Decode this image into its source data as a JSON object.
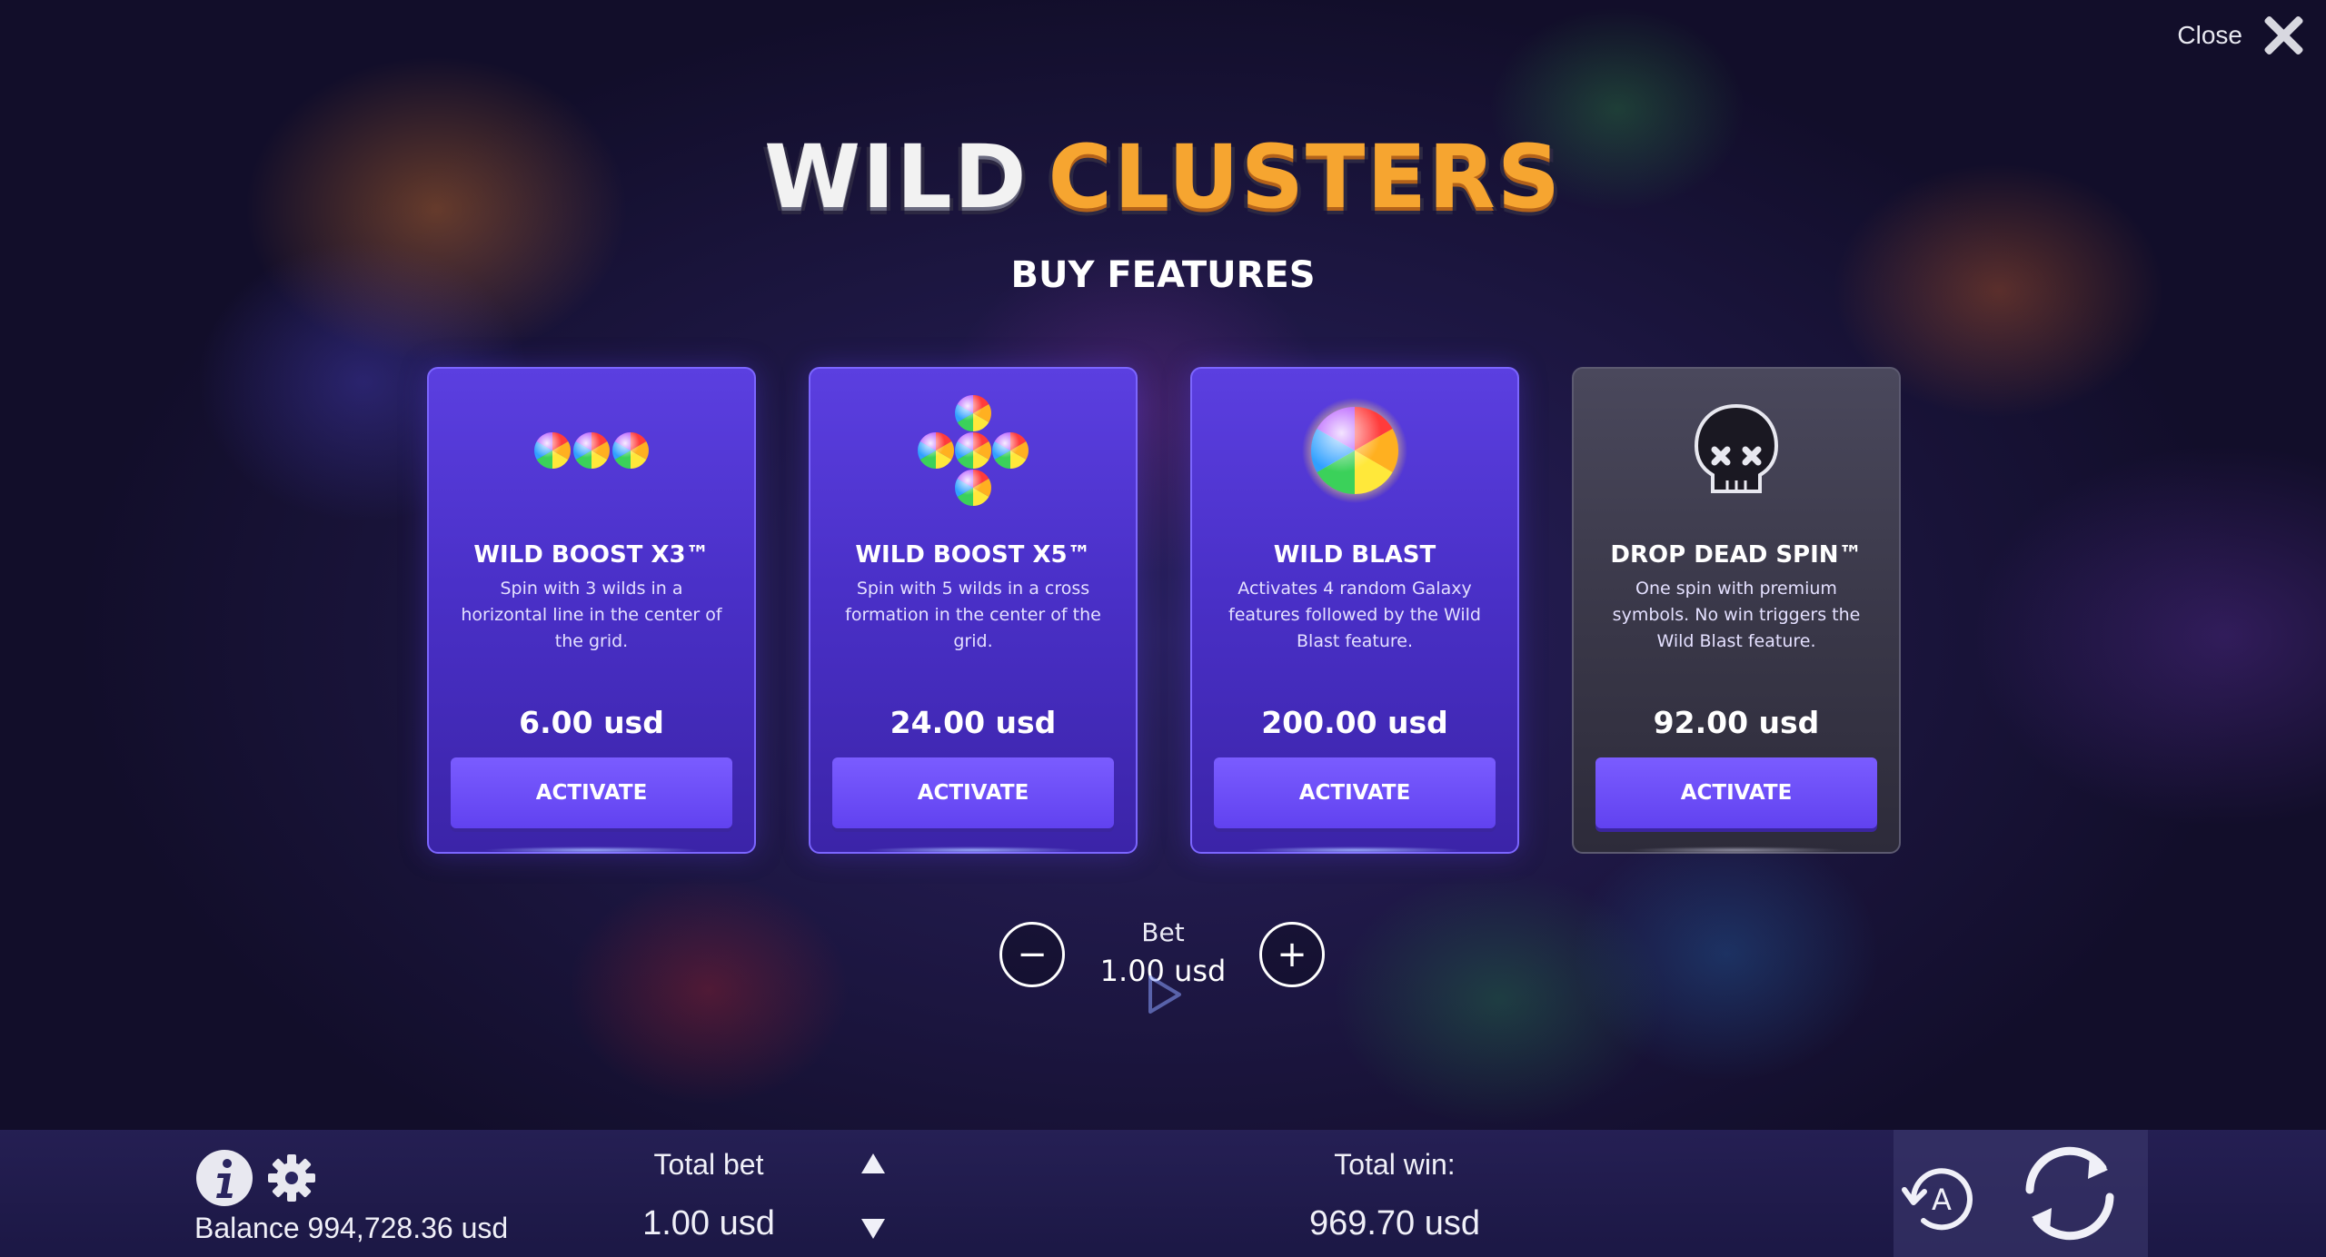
{
  "close": {
    "label": "Close"
  },
  "logo": {
    "word1": "WILD",
    "word2": "CLUSTERS"
  },
  "heading": "BUY FEATURES",
  "cards": [
    {
      "title": "WILD BOOST X3™",
      "description": "Spin with 3 wilds in a horizontal line in the center of the grid.",
      "price": "6.00 usd",
      "button": "ACTIVATE",
      "icon": "three-wild-orbs-icon"
    },
    {
      "title": "WILD BOOST X5™",
      "description": "Spin with 5 wilds in a cross formation in the center of the grid.",
      "price": "24.00 usd",
      "button": "ACTIVATE",
      "icon": "cross-wild-orbs-icon"
    },
    {
      "title": "WILD BLAST",
      "description": "Activates 4 random Galaxy features followed by the Wild Blast feature.",
      "price": "200.00 usd",
      "button": "ACTIVATE",
      "icon": "rainbow-orb-icon"
    },
    {
      "title": "DROP DEAD SPIN™",
      "description": "One spin with premium symbols. No win triggers the Wild Blast feature.",
      "price": "92.00 usd",
      "button": "ACTIVATE",
      "icon": "skull-icon"
    }
  ],
  "bet": {
    "label": "Bet",
    "value": "1.00 usd",
    "minus": "−",
    "plus": "+"
  },
  "bottom_bar": {
    "balance": "Balance 994,728.36 usd",
    "total_bet_label": "Total bet",
    "total_bet_value": "1.00 usd",
    "total_win_label": "Total win:",
    "total_win_value": "969.70 usd"
  },
  "colors": {
    "card_purple": "#5b3fe0",
    "card_dark": "#3a3849",
    "button": "#6a4cf6",
    "logo_orange": "#f6a530"
  }
}
